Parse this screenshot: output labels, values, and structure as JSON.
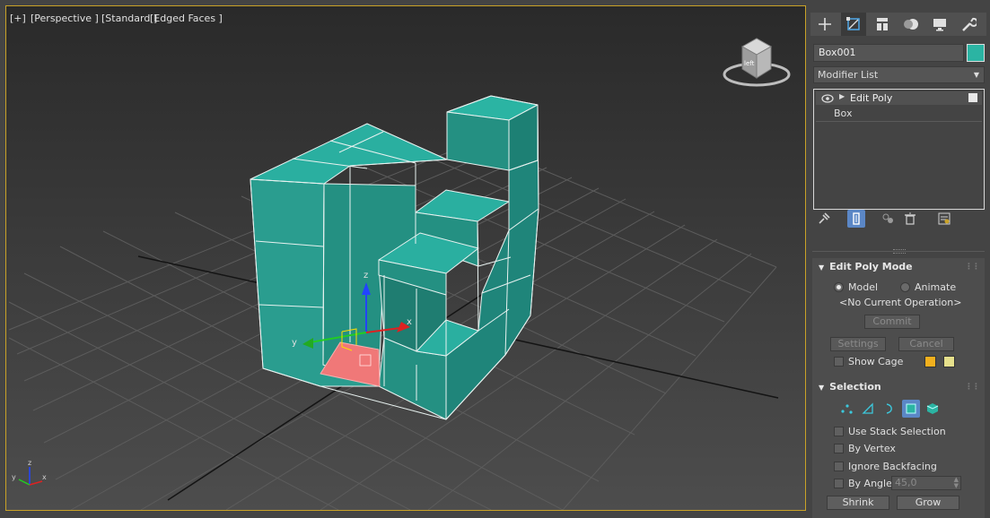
{
  "viewport": {
    "label_plus": "[+]",
    "label_view": "[Perspective ]",
    "label_shading": "[Standard ]",
    "label_edges": "[Edged Faces ]",
    "gizmo_z": "z",
    "gizmo_y": "y",
    "gizmo_x": "x",
    "corner_axis_z": "z",
    "corner_axis_y": "y",
    "corner_axis_x": "x",
    "viewcube_face": "left"
  },
  "command_panel": {
    "tabs": [
      "create-icon",
      "modify-icon",
      "hierarchy-icon",
      "motion-icon",
      "display-icon",
      "utilities-icon"
    ],
    "object_name": "Box001",
    "object_color": "#2bb4a3",
    "modifier_list_label": "Modifier List",
    "stack": {
      "modifier": "Edit Poly",
      "base": "Box"
    }
  },
  "edit_poly_mode": {
    "title": "Edit Poly Mode",
    "model_label": "Model",
    "animate_label": "Animate",
    "operation_status": "<No Current Operation>",
    "commit_label": "Commit",
    "settings_label": "Settings",
    "cancel_label": "Cancel",
    "show_cage_label": "Show Cage",
    "cage_color_1": "#f2b01e",
    "cage_color_2": "#e6e08c"
  },
  "selection": {
    "title": "Selection",
    "use_stack_label": "Use Stack Selection",
    "by_vertex_label": "By Vertex",
    "ignore_backfacing_label": "Ignore Backfacing",
    "by_angle_label": "By Angle:",
    "by_angle_value": "45,0",
    "shrink_label": "Shrink",
    "grow_label": "Grow"
  },
  "colors": {
    "accent": "#2bb4a3",
    "selected_face": "#f07878",
    "viewport_border": "#c9a227"
  }
}
